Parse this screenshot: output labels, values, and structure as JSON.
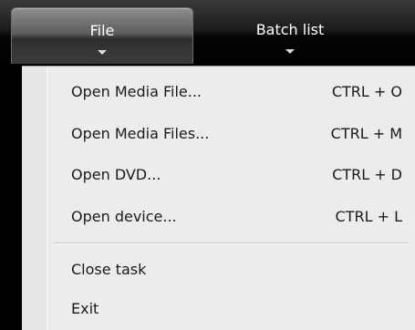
{
  "tabs": [
    {
      "label": "File",
      "active": true
    },
    {
      "label": "Batch list",
      "active": false
    }
  ],
  "menu": {
    "items": [
      {
        "label": "Open Media File...",
        "shortcut": "CTRL + O"
      },
      {
        "label": "Open Media Files...",
        "shortcut": "CTRL + M"
      },
      {
        "label": "Open DVD...",
        "shortcut": "CTRL + D"
      },
      {
        "label": "Open device...",
        "shortcut": "CTRL + L"
      },
      {
        "label": "Close task",
        "shortcut": ""
      },
      {
        "label": "Exit",
        "shortcut": ""
      }
    ]
  },
  "icons": {
    "tab_dropdown": "chevron-down-icon"
  },
  "colors": {
    "tab_text": "#ffffff",
    "menu_background": "#ececec",
    "menu_text": "#1a1a1a",
    "tabbar_background": "#000000"
  }
}
